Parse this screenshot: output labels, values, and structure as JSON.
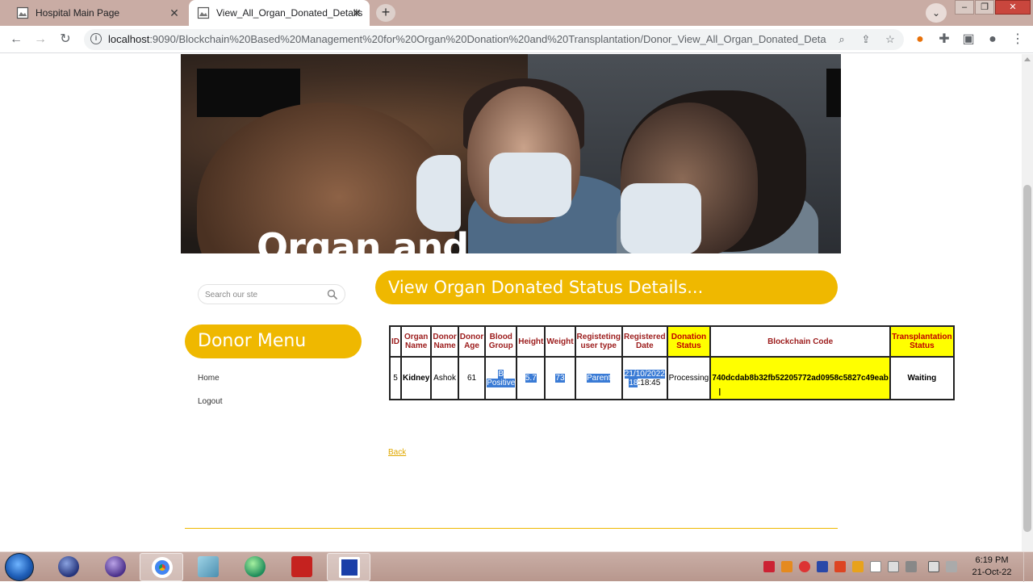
{
  "browser": {
    "tabs": [
      {
        "title": "Hospital Main Page",
        "active": false
      },
      {
        "title": "View_All_Organ_Donated_Details",
        "active": true
      }
    ],
    "url_host": "localhost",
    "url_path": ":9090/Blockchain%20Based%20Management%20for%20Organ%20Donation%20and%20Transplantation/Donor_View_All_Organ_Donated_Detai..."
  },
  "banner": {
    "text": "Organ and"
  },
  "search": {
    "placeholder": "Search our ste"
  },
  "sidebar": {
    "heading": "Donor Menu",
    "items": [
      {
        "label": "Home"
      },
      {
        "label": "Logout"
      }
    ]
  },
  "main": {
    "heading": "View Organ Donated Status Details...",
    "back_link": "Back"
  },
  "table": {
    "headers": [
      "ID",
      "Organ Name",
      "Donor Name",
      "Donor Age",
      "Blood Group",
      "Height",
      "Weight",
      "Registeting user type",
      "Registered Date",
      "Donation Status",
      "Blockchain Code",
      "Transplantation Status"
    ],
    "rows": [
      {
        "id": "5",
        "organ": "Kidney",
        "donor_name": "Ashok",
        "donor_age": "61",
        "blood_group_1": "B",
        "blood_group_2": "Positive",
        "height": "5.7",
        "weight": "73",
        "user_type": "Parent",
        "reg_date_1": "21/10/2022",
        "reg_date_2a": "18",
        "reg_date_2b": ":18:45",
        "donation_status": "Processing",
        "blockchain_code": "740dcdab8b32fb52205772ad0958c5827c49eab",
        "transplant_status": "Waiting"
      }
    ]
  },
  "taskbar": {
    "time": "6:19 PM",
    "date": "21-Oct-22"
  },
  "colors": {
    "accent": "#efb800",
    "highlight": "#ffff00",
    "header_text": "#9c1c1c",
    "selection": "#3a7bd5"
  }
}
